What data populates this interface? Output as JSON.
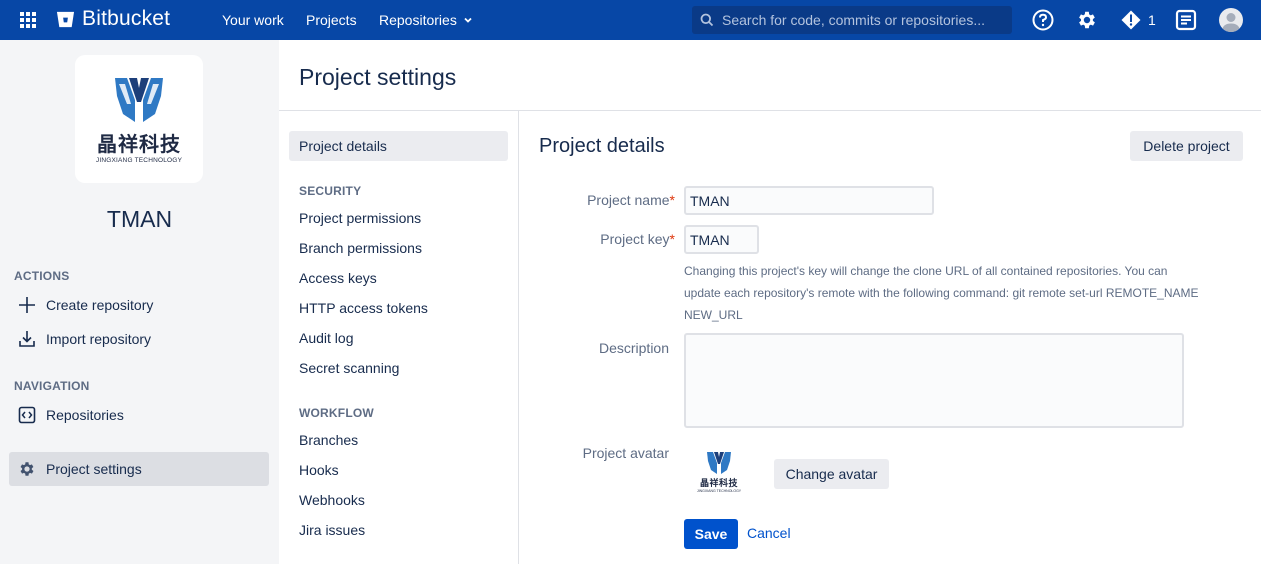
{
  "topbar": {
    "brand": "Bitbucket",
    "nav": {
      "your_work": "Your work",
      "projects": "Projects",
      "repositories": "Repositories"
    },
    "search_placeholder": "Search for code, commits or repositories...",
    "alert_count": "1",
    "colors": {
      "bar": "#0747a6",
      "text": "#ffffff"
    }
  },
  "sidebar": {
    "logo_text_cn": "晶祥科技",
    "logo_text_en": "JINGXIANG TECHNOLOGY",
    "project_name": "TMAN",
    "actions_heading": "ACTIONS",
    "actions": [
      {
        "label": "Create repository",
        "icon": "plus-icon"
      },
      {
        "label": "Import repository",
        "icon": "import-icon"
      }
    ],
    "navigation_heading": "NAVIGATION",
    "navigation": [
      {
        "label": "Repositories",
        "icon": "code-icon"
      },
      {
        "label": "Project settings",
        "icon": "gear-icon",
        "active": true
      }
    ]
  },
  "page": {
    "title": "Project settings"
  },
  "settings_nav": {
    "active_item": "Project details",
    "security_heading": "SECURITY",
    "security": [
      "Project permissions",
      "Branch permissions",
      "Access keys",
      "HTTP access tokens",
      "Audit log",
      "Secret scanning"
    ],
    "workflow_heading": "WORKFLOW",
    "workflow": [
      "Branches",
      "Hooks",
      "Webhooks",
      "Jira issues"
    ]
  },
  "form": {
    "section_title": "Project details",
    "delete_label": "Delete project",
    "project_name_label": "Project name",
    "project_name_value": "TMAN",
    "project_key_label": "Project key",
    "project_key_value": "TMAN",
    "required_marker": "*",
    "key_help_line1": "Changing this project's key will change the clone URL of all contained repositories. You can",
    "key_help_line2": "update each repository's remote with the following command: git remote set-url REMOTE_NAME",
    "key_help_line3": "NEW_URL",
    "description_label": "Description",
    "description_value": "",
    "avatar_label": "Project avatar",
    "change_avatar_label": "Change avatar",
    "save_label": "Save",
    "cancel_label": "Cancel",
    "colors": {
      "primary": "#0052cc",
      "required": "#de350b"
    }
  }
}
